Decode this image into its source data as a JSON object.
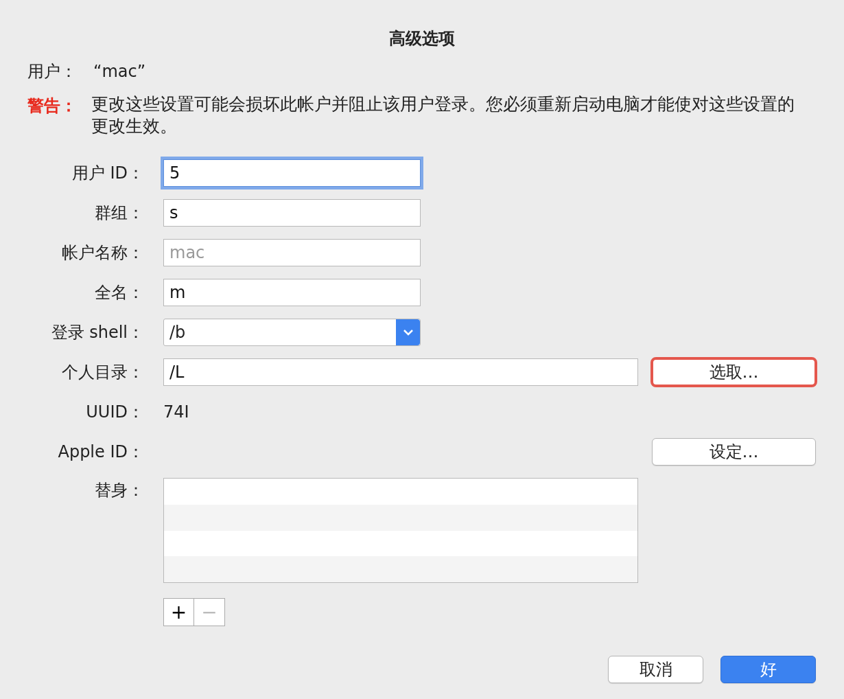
{
  "dialog": {
    "title": "高级选项"
  },
  "user": {
    "label": "用户：",
    "value": "“mac”"
  },
  "warning": {
    "label": "警告：",
    "text": "更改这些设置可能会损坏此帐户并阻止该用户登录。您必须重新启动电脑才能使对这些设置的更改生效。"
  },
  "fields": [
    {
      "label": "用户 ID：",
      "kind": "text",
      "value": "5",
      "focused": true
    },
    {
      "label": "群组：",
      "kind": "text",
      "value": "s",
      "focused": false
    },
    {
      "label": "帐户名称：",
      "kind": "text",
      "placeholder": "mac",
      "focused": false
    },
    {
      "label": "全名：",
      "kind": "text",
      "value": "m",
      "focused": false
    },
    {
      "label": "登录 shell：",
      "kind": "popup",
      "value": "/b"
    },
    {
      "label": "个人目录：",
      "kind": "wide",
      "value": "/L",
      "button": {
        "label": "选取…",
        "highlighted": true
      }
    },
    {
      "label": "UUID：",
      "kind": "static",
      "value": "74I"
    },
    {
      "label": "Apple ID：",
      "kind": "static",
      "button": {
        "label": "设定…",
        "highlighted": false
      }
    },
    {
      "label": "替身：",
      "kind": "list"
    }
  ],
  "list_buttons": [
    {
      "label": "+",
      "disabled": false
    },
    {
      "label": "−",
      "disabled": true
    }
  ],
  "buttons": [
    {
      "label": "取消",
      "default": false
    },
    {
      "label": "好",
      "default": true
    }
  ]
}
